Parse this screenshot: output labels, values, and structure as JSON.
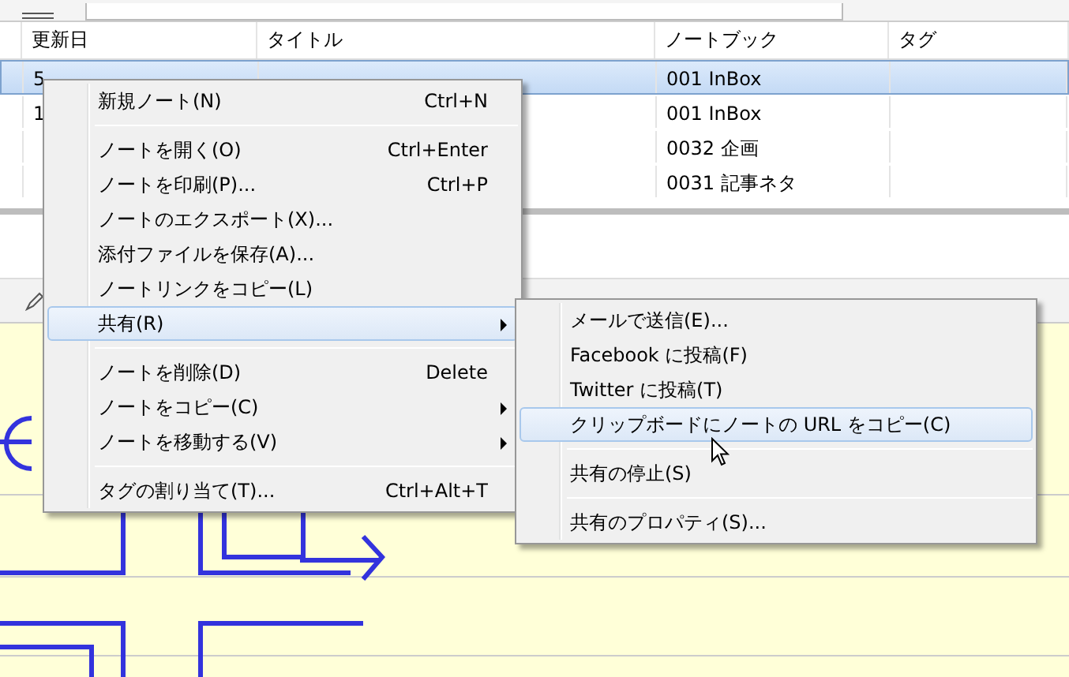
{
  "table": {
    "columns": [
      "更新日",
      "タイトル",
      "ノートブック",
      "タグ"
    ],
    "rows": [
      {
        "updated": "5",
        "notebook": "001 InBox",
        "selected": true
      },
      {
        "updated": "1",
        "notebook": "001 InBox",
        "selected": false
      },
      {
        "notebook": "0032 企画",
        "selected": false
      },
      {
        "notebook": "0031 記事ネタ",
        "selected": false
      }
    ]
  },
  "context_menu": {
    "items": [
      {
        "kind": "item",
        "label": "新規ノート(N)",
        "shortcut": "Ctrl+N",
        "submenu": false,
        "selected": false
      },
      {
        "kind": "separator"
      },
      {
        "kind": "item",
        "label": "ノートを開く(O)",
        "shortcut": "Ctrl+Enter",
        "submenu": false,
        "selected": false
      },
      {
        "kind": "item",
        "label": "ノートを印刷(P)...",
        "shortcut": "Ctrl+P",
        "submenu": false,
        "selected": false
      },
      {
        "kind": "item",
        "label": "ノートのエクスポート(X)...",
        "submenu": false,
        "selected": false
      },
      {
        "kind": "item",
        "label": "添付ファイルを保存(A)...",
        "submenu": false,
        "selected": false
      },
      {
        "kind": "item",
        "label": "ノートリンクをコピー(L)",
        "submenu": false,
        "selected": false
      },
      {
        "kind": "item",
        "label": "共有(R)",
        "submenu": true,
        "selected": true
      },
      {
        "kind": "separator"
      },
      {
        "kind": "item",
        "label": "ノートを削除(D)",
        "shortcut": "Delete",
        "submenu": false,
        "selected": false
      },
      {
        "kind": "item",
        "label": "ノートをコピー(C)",
        "submenu": true,
        "selected": false
      },
      {
        "kind": "item",
        "label": "ノートを移動する(V)",
        "submenu": true,
        "selected": false
      },
      {
        "kind": "separator"
      },
      {
        "kind": "item",
        "label": "タグの割り当て(T)...",
        "shortcut": "Ctrl+Alt+T",
        "submenu": false,
        "selected": false
      }
    ]
  },
  "share_submenu": {
    "items": [
      {
        "kind": "item",
        "label": "メールで送信(E)...",
        "selected": false
      },
      {
        "kind": "item",
        "label": "Facebook に投稿(F)",
        "selected": false
      },
      {
        "kind": "item",
        "label": "Twitter に投稿(T)",
        "selected": false
      },
      {
        "kind": "item",
        "label": "クリップボードにノートの URL をコピー(C)",
        "selected": true
      },
      {
        "kind": "separator"
      },
      {
        "kind": "item",
        "label": "共有の停止(S)",
        "selected": false
      },
      {
        "kind": "separator"
      },
      {
        "kind": "item",
        "label": "共有のプロパティ(S)...",
        "selected": false
      }
    ]
  }
}
